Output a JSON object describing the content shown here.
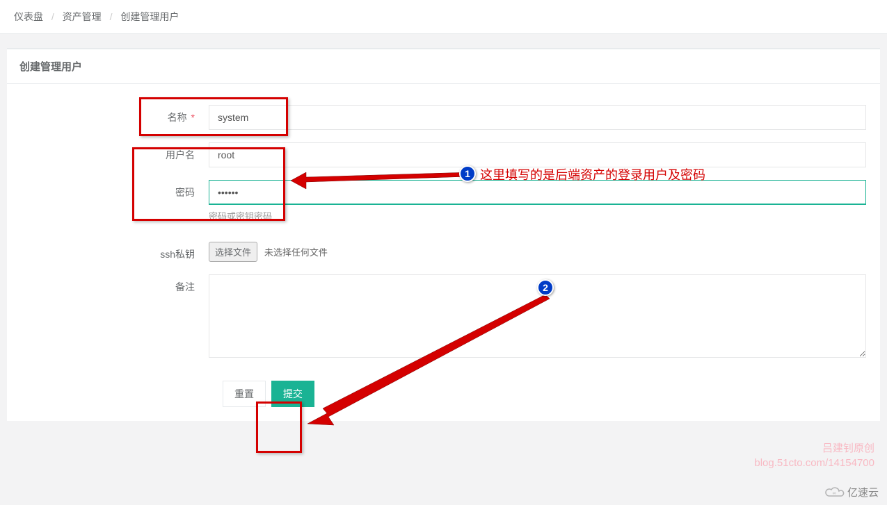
{
  "breadcrumb": {
    "item1": "仪表盘",
    "item2": "资产管理",
    "item3": "创建管理用户",
    "sep": "/"
  },
  "panel": {
    "title": "创建管理用户"
  },
  "form": {
    "name_label": "名称",
    "name_value": "system",
    "required_mark": "*",
    "username_label": "用户名",
    "username_value": "root",
    "password_label": "密码",
    "password_value": "••••••",
    "password_help": "密码或密钥密码",
    "sshkey_label": "ssh私钥",
    "file_button": "选择文件",
    "file_status": "未选择任何文件",
    "comment_label": "备注",
    "comment_value": "",
    "reset_label": "重置",
    "submit_label": "提交"
  },
  "annotations": {
    "badge1": "1",
    "badge2": "2",
    "note1": "这里填写的是后端资产的登录用户及密码"
  },
  "watermark": {
    "line1": "吕建钊原创",
    "line2": "blog.51cto.com/14154700",
    "brand": "亿速云"
  }
}
